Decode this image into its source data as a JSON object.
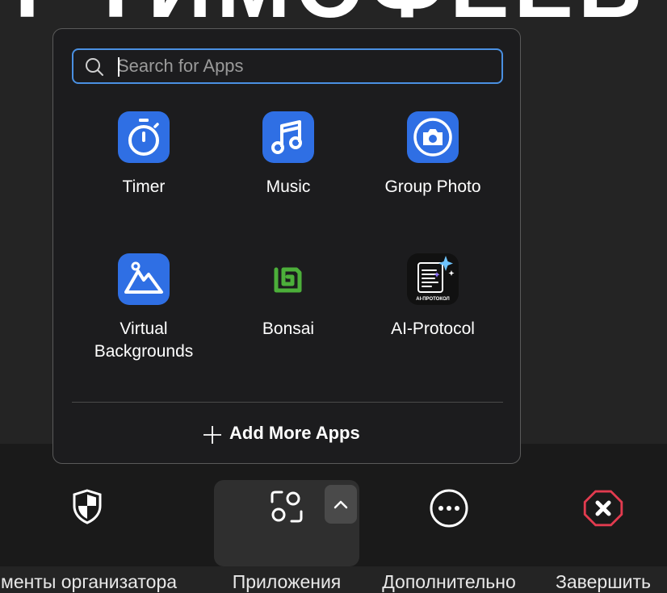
{
  "background": {
    "title_text": "Т ТИМОФЕЕВ"
  },
  "apps_popup": {
    "search": {
      "placeholder": "Search for Apps",
      "value": ""
    },
    "apps": [
      {
        "label": "Timer",
        "icon": "timer-icon"
      },
      {
        "label": "Music",
        "icon": "music-icon"
      },
      {
        "label": "Group Photo",
        "icon": "camera-icon"
      },
      {
        "label": "Virtual Backgrounds",
        "icon": "mountain-image-icon"
      },
      {
        "label": "Bonsai",
        "icon": "bonsai-logo-icon"
      },
      {
        "label": "AI-Protocol",
        "icon": "ai-protocol-document-icon",
        "icon_caption": "AI-ПРОТОКОЛ"
      }
    ],
    "add_more_label": "Add More Apps"
  },
  "toolbar": {
    "items": [
      {
        "label": "менты организатора",
        "icon": "shield-icon"
      },
      {
        "label": "Приложения",
        "icon": "apps-icon"
      },
      {
        "label": "Дополнительно",
        "icon": "more-icon"
      },
      {
        "label": "Завершить",
        "icon": "end-icon"
      }
    ]
  },
  "colors": {
    "accent": "#2f6fe4",
    "focus_ring": "#4a90e2",
    "end_red": "#e23b4f",
    "bonsai_green": "#4caf3a"
  }
}
